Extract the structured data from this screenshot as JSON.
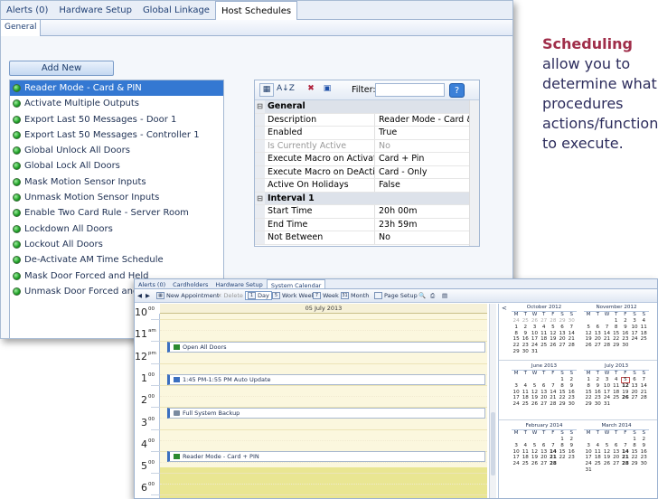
{
  "win1": {
    "tabs": [
      "Alerts (0)",
      "Hardware Setup",
      "Global Linkage",
      "Host Schedules"
    ],
    "active_tab": 3,
    "subtab": "General",
    "add_new": "Add New",
    "schedules": [
      "Reader Mode - Card & PIN",
      "Activate Multiple Outputs",
      "Export Last 50 Messages - Door 1",
      "Export Last 50 Messages - Controller 1",
      "Global Unlock All Doors",
      "Global Lock All Doors",
      "Mask Motion Sensor Inputs",
      "Unmask Motion Sensor Inputs",
      "Enable Two Card Rule - Server Room",
      "Lockdown All Doors",
      "Lockout All Doors",
      "De-Activate AM Time Schedule",
      "Mask Door Forced and Held",
      "Unmask Door Forced and Held"
    ],
    "selected": 0,
    "propgrid": {
      "filter_label": "Filter:",
      "sort_label": "A↓Z",
      "help": "?",
      "rows": [
        {
          "type": "cat",
          "k": "General"
        },
        {
          "k": "Description",
          "v": "Reader Mode - Card & P..."
        },
        {
          "k": "Enabled",
          "v": "True"
        },
        {
          "k": "Is Currently Active",
          "v": "No",
          "dis": true
        },
        {
          "k": "Execute Macro on Activate",
          "v": "Card + Pin"
        },
        {
          "k": "Execute Macro on DeActiv...",
          "v": "Card - Only"
        },
        {
          "k": "Active On Holidays",
          "v": "False"
        },
        {
          "type": "cat",
          "k": "Interval 1"
        },
        {
          "k": "Start Time",
          "v": "20h 00m"
        },
        {
          "k": "End Time",
          "v": "23h 59m"
        },
        {
          "k": "Not Between",
          "v": "No"
        }
      ]
    }
  },
  "side": {
    "bold": "Scheduling",
    "rest": "allow you to determine what procedures actions/functions to execute."
  },
  "win2": {
    "tabs": [
      "Alerts (0)",
      "Cardholders",
      "Hardware Setup",
      "System Calendar"
    ],
    "active_tab": 3,
    "toolbar": {
      "new_appt": "New Appointment",
      "delete": "Delete",
      "day": "Day",
      "day_num": "1",
      "workweek": "Work Week",
      "workweek_num": "5",
      "week": "Week",
      "week_num": "7",
      "month": "Month",
      "month_num": "31",
      "page_setup": "Page Setup"
    },
    "date_header": "05 July 2013",
    "hours": [
      {
        "h": "10",
        "s": "00"
      },
      {
        "h": "11",
        "s": "am"
      },
      {
        "h": "12",
        "s": "pm"
      },
      {
        "h": "1",
        "s": "00"
      },
      {
        "h": "2",
        "s": "00"
      },
      {
        "h": "3",
        "s": "00"
      },
      {
        "h": "4",
        "s": "00"
      },
      {
        "h": "5",
        "s": "00"
      },
      {
        "h": "6",
        "s": "00"
      }
    ],
    "appointments": [
      {
        "text": "Open All Doors",
        "icon": "flag"
      },
      {
        "text": "1:45 PM-1:55 PM Auto Update",
        "icon": "recur"
      },
      {
        "text": "Full System Backup",
        "icon": "db"
      },
      {
        "text": "Reader Mode - Card + PIN",
        "icon": "flag"
      }
    ],
    "dow": [
      "M",
      "T",
      "W",
      "T",
      "F",
      "S",
      "S"
    ],
    "months": [
      {
        "name": "October 2012",
        "weeks": [
          [
            "24",
            "25",
            "26",
            "27",
            "28",
            "29",
            "30"
          ],
          [
            "1",
            "2",
            "3",
            "4",
            "5",
            "6",
            "7"
          ],
          [
            "8",
            "9",
            "10",
            "11",
            "12",
            "13",
            "14"
          ],
          [
            "15",
            "16",
            "17",
            "18",
            "19",
            "20",
            "21"
          ],
          [
            "22",
            "23",
            "24",
            "25",
            "26",
            "27",
            "28"
          ],
          [
            "29",
            "30",
            "31",
            "",
            "",
            "",
            ""
          ]
        ]
      },
      {
        "name": "November 2012",
        "weeks": [
          [
            "",
            "",
            "",
            "1",
            "2",
            "3",
            "4"
          ],
          [
            "5",
            "6",
            "7",
            "8",
            "9",
            "10",
            "11"
          ],
          [
            "12",
            "13",
            "14",
            "15",
            "16",
            "17",
            "18"
          ],
          [
            "19",
            "20",
            "21",
            "22",
            "23",
            "24",
            "25"
          ],
          [
            "26",
            "27",
            "28",
            "29",
            "30",
            "",
            ""
          ]
        ]
      },
      {
        "name": "June 2013",
        "weeks": [
          [
            "",
            "",
            "",
            "",
            "",
            "1",
            "2"
          ],
          [
            "3",
            "4",
            "5",
            "6",
            "7",
            "8",
            "9"
          ],
          [
            "10",
            "11",
            "12",
            "13",
            "14",
            "15",
            "16"
          ],
          [
            "17",
            "18",
            "19",
            "20",
            "21",
            "22",
            "23"
          ],
          [
            "24",
            "25",
            "26",
            "27",
            "28",
            "29",
            "30"
          ]
        ]
      },
      {
        "name": "July 2013",
        "weeks": [
          [
            "1",
            "2",
            "3",
            "4",
            "5",
            "6",
            "7"
          ],
          [
            "8",
            "9",
            "10",
            "11",
            "12",
            "13",
            "14"
          ],
          [
            "15",
            "16",
            "17",
            "18",
            "19",
            "20",
            "21"
          ],
          [
            "22",
            "23",
            "24",
            "25",
            "26",
            "27",
            "28"
          ],
          [
            "29",
            "30",
            "31",
            "",
            "",
            "",
            ""
          ]
        ]
      },
      {
        "name": "February 2014",
        "weeks": [
          [
            "",
            "",
            "",
            "",
            "",
            "1",
            "2"
          ],
          [
            "3",
            "4",
            "5",
            "6",
            "7",
            "8",
            "9"
          ],
          [
            "10",
            "11",
            "12",
            "13",
            "14",
            "15",
            "16"
          ],
          [
            "17",
            "18",
            "19",
            "20",
            "21",
            "22",
            "23"
          ],
          [
            "24",
            "25",
            "26",
            "27",
            "28",
            "",
            ""
          ]
        ]
      },
      {
        "name": "March 2014",
        "weeks": [
          [
            "",
            "",
            "",
            "",
            "",
            "1",
            "2"
          ],
          [
            "3",
            "4",
            "5",
            "6",
            "7",
            "8",
            "9"
          ],
          [
            "10",
            "11",
            "12",
            "13",
            "14",
            "15",
            "16"
          ],
          [
            "17",
            "18",
            "19",
            "20",
            "21",
            "22",
            "23"
          ],
          [
            "24",
            "25",
            "26",
            "27",
            "28",
            "29",
            "30"
          ],
          [
            "31",
            "",
            "",
            "",
            "",
            "",
            ""
          ]
        ]
      }
    ],
    "nav_prev": "<"
  }
}
